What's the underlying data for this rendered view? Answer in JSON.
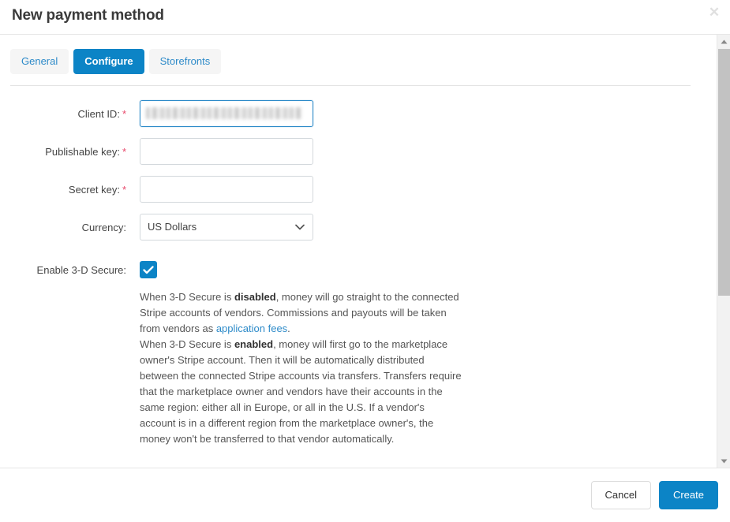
{
  "modal": {
    "title": "New payment method",
    "close_icon": "close-icon"
  },
  "tabs": [
    {
      "label": "General",
      "active": false
    },
    {
      "label": "Configure",
      "active": true
    },
    {
      "label": "Storefronts",
      "active": false
    }
  ],
  "form": {
    "client_id": {
      "label": "Client ID:",
      "required_marker": "*",
      "value": "",
      "placeholder": "",
      "redacted": true,
      "focused": true
    },
    "publishable_key": {
      "label": "Publishable key:",
      "required_marker": "*",
      "value": "",
      "placeholder": ""
    },
    "secret_key": {
      "label": "Secret key:",
      "required_marker": "*",
      "value": "",
      "placeholder": ""
    },
    "currency": {
      "label": "Currency:",
      "selected": "US Dollars",
      "caret_icon": "chevron-down-icon"
    },
    "three_d_secure": {
      "label": "Enable 3-D Secure:",
      "checked": true,
      "check_icon": "check-icon"
    }
  },
  "description": {
    "p1_a": "When 3-D Secure is ",
    "p1_bold": "disabled",
    "p1_b": ", money will go straight to the connected Stripe accounts of vendors. Commissions and payouts will be taken from vendors as ",
    "p1_link": "application fees",
    "p1_c": ".",
    "p2_a": "When 3-D Secure is ",
    "p2_bold": "enabled",
    "p2_b": ", money will first go to the marketplace owner's Stripe account. Then it will be automatically distributed between the connected Stripe accounts via transfers. Transfers require that the marketplace owner and vendors have their accounts in the same region: either all in Europe, or all in the U.S. If a vendor's account is in a different region from the marketplace owner's, the money won't be transferred to that vendor automatically."
  },
  "scrollbar": {
    "up_icon": "scroll-up-arrow-icon",
    "down_icon": "scroll-down-arrow-icon"
  },
  "footer": {
    "cancel_label": "Cancel",
    "create_label": "Create"
  },
  "colors": {
    "accent": "#0c84c6",
    "link": "#2e8bc9",
    "required": "#e8486b",
    "border": "#d3d8dc",
    "tab_inactive_bg": "#f5f5f5",
    "scroll_thumb": "#c2c2c2"
  }
}
